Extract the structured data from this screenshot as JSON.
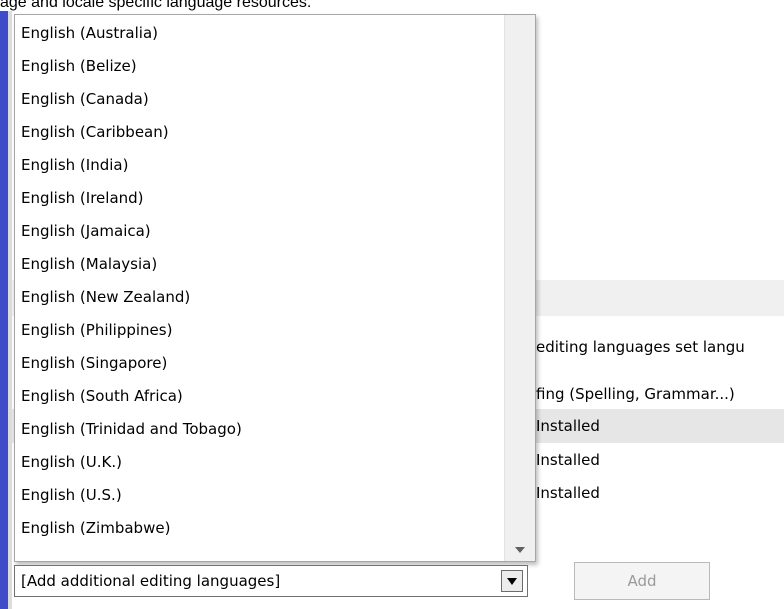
{
  "background": {
    "top_text": "age and locale specific language resources.",
    "right_lines": [
      "editing languages set langu",
      "fing (Spelling, Grammar...)",
      "Installed",
      "Installed",
      "Installed"
    ]
  },
  "dropdown": {
    "items": [
      "English (Australia)",
      "English (Belize)",
      "English (Canada)",
      "English (Caribbean)",
      "English (India)",
      "English (Ireland)",
      "English (Jamaica)",
      "English (Malaysia)",
      "English (New Zealand)",
      "English (Philippines)",
      "English (Singapore)",
      "English (South Africa)",
      "English (Trinidad and Tobago)",
      "English (U.K.)",
      "English (U.S.)",
      "English (Zimbabwe)"
    ]
  },
  "combo": {
    "value": "[Add additional editing languages]"
  },
  "add_button": {
    "label": "Add"
  },
  "colors": {
    "accent": "#3f4cc9",
    "highlight_row": "#e6e6e6"
  }
}
